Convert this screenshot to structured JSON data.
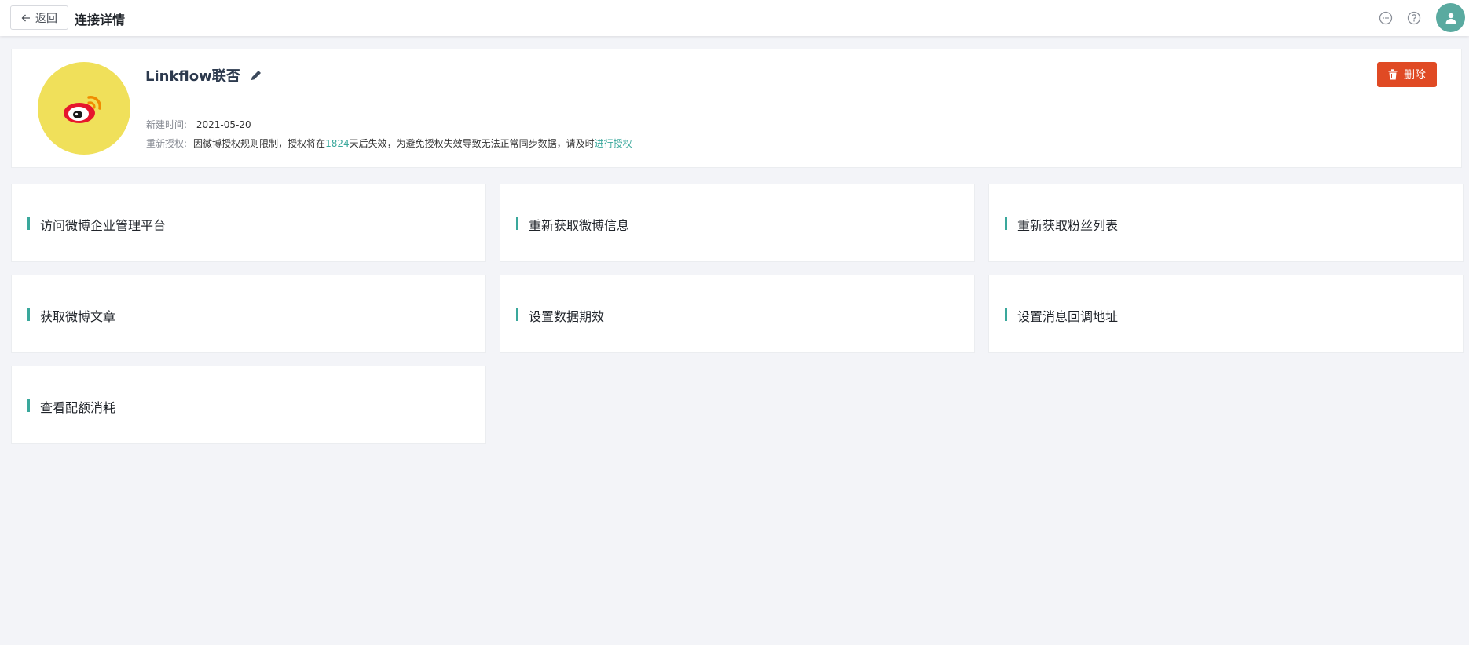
{
  "header": {
    "back_label": "返回",
    "title": "连接详情",
    "icons": [
      "chat-icon",
      "help-icon",
      "user-avatar-icon"
    ]
  },
  "connection": {
    "name": "Linkflow联否",
    "logo_icon": "weibo-logo-icon",
    "logo_bg": "#f0e05a",
    "created_label": "新建时间:",
    "created_value": "2021-05-20",
    "reauth_label": "重新授权:",
    "reauth_text_before": "因微博授权规则限制，授权将在",
    "reauth_days": "1824",
    "reauth_text_after": "天后失效，为避免授权失效导致无法正常同步数据，请及时",
    "reauth_link": "进行授权",
    "delete_label": "删除"
  },
  "colors": {
    "accent": "#3aa89c",
    "danger": "#e04a24",
    "avatar": "#5aaaa0"
  },
  "actions": [
    {
      "label": "访问微博企业管理平台"
    },
    {
      "label": "重新获取微博信息"
    },
    {
      "label": "重新获取粉丝列表"
    },
    {
      "label": "获取微博文章"
    },
    {
      "label": "设置数据期效"
    },
    {
      "label": "设置消息回调地址"
    },
    {
      "label": "查看配额消耗"
    }
  ]
}
